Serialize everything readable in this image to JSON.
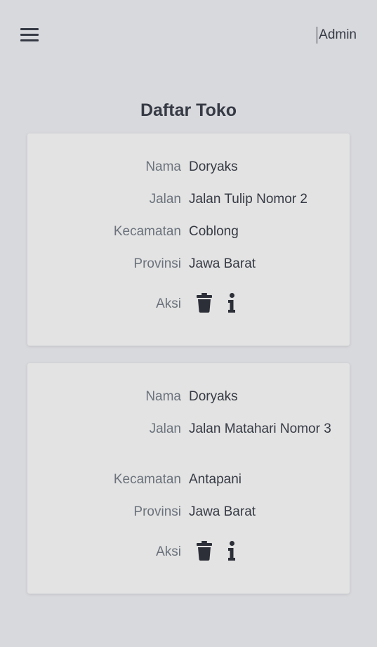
{
  "header": {
    "menu_icon": "hamburger-icon",
    "user_label": "Admin"
  },
  "page": {
    "title": "Daftar Toko"
  },
  "stores": [
    {
      "nama_label": "Nama",
      "nama": "Doryaks",
      "jalan_label": "Jalan",
      "jalan": "Jalan Tulip Nomor 2",
      "kecamatan_label": "Kecamatan",
      "kecamatan": "Coblong",
      "provinsi_label": "Provinsi",
      "provinsi": "Jawa Barat",
      "aksi_label": "Aksi",
      "delete_icon": "trash-icon",
      "info_icon": "info-icon"
    },
    {
      "nama_label": "Nama",
      "nama": "Doryaks",
      "jalan_label": "Jalan",
      "jalan": "Jalan Matahari Nomor 3",
      "kecamatan_label": "Kecamatan",
      "kecamatan": "Antapani",
      "provinsi_label": "Provinsi",
      "provinsi": "Jawa Barat",
      "aksi_label": "Aksi",
      "delete_icon": "trash-icon",
      "info_icon": "info-icon"
    }
  ]
}
